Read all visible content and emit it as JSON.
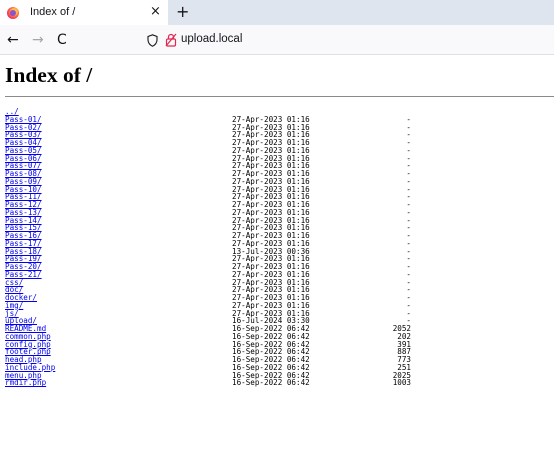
{
  "browser": {
    "tab_title": "Index of /",
    "tab_close": "×",
    "new_tab": "+",
    "back": "←",
    "forward": "→",
    "reload": "C",
    "url": "upload.local"
  },
  "page": {
    "heading": "Index of /",
    "parent_link": "../",
    "entries": [
      {
        "name": "Pass-01/",
        "date": "27-Apr-2023 01:16",
        "size": "-"
      },
      {
        "name": "Pass-02/",
        "date": "27-Apr-2023 01:16",
        "size": "-"
      },
      {
        "name": "Pass-03/",
        "date": "27-Apr-2023 01:16",
        "size": "-"
      },
      {
        "name": "Pass-04/",
        "date": "27-Apr-2023 01:16",
        "size": "-"
      },
      {
        "name": "Pass-05/",
        "date": "27-Apr-2023 01:16",
        "size": "-"
      },
      {
        "name": "Pass-06/",
        "date": "27-Apr-2023 01:16",
        "size": "-"
      },
      {
        "name": "Pass-07/",
        "date": "27-Apr-2023 01:16",
        "size": "-"
      },
      {
        "name": "Pass-08/",
        "date": "27-Apr-2023 01:16",
        "size": "-"
      },
      {
        "name": "Pass-09/",
        "date": "27-Apr-2023 01:16",
        "size": "-"
      },
      {
        "name": "Pass-10/",
        "date": "27-Apr-2023 01:16",
        "size": "-"
      },
      {
        "name": "Pass-11/",
        "date": "27-Apr-2023 01:16",
        "size": "-"
      },
      {
        "name": "Pass-12/",
        "date": "27-Apr-2023 01:16",
        "size": "-"
      },
      {
        "name": "Pass-13/",
        "date": "27-Apr-2023 01:16",
        "size": "-"
      },
      {
        "name": "Pass-14/",
        "date": "27-Apr-2023 01:16",
        "size": "-"
      },
      {
        "name": "Pass-15/",
        "date": "27-Apr-2023 01:16",
        "size": "-"
      },
      {
        "name": "Pass-16/",
        "date": "27-Apr-2023 01:16",
        "size": "-"
      },
      {
        "name": "Pass-17/",
        "date": "27-Apr-2023 01:16",
        "size": "-"
      },
      {
        "name": "Pass-18/",
        "date": "13-Jul-2023 00:36",
        "size": "-"
      },
      {
        "name": "Pass-19/",
        "date": "27-Apr-2023 01:16",
        "size": "-"
      },
      {
        "name": "Pass-20/",
        "date": "27-Apr-2023 01:16",
        "size": "-"
      },
      {
        "name": "Pass-21/",
        "date": "27-Apr-2023 01:16",
        "size": "-"
      },
      {
        "name": "css/",
        "date": "27-Apr-2023 01:16",
        "size": "-"
      },
      {
        "name": "doc/",
        "date": "27-Apr-2023 01:16",
        "size": "-"
      },
      {
        "name": "docker/",
        "date": "27-Apr-2023 01:16",
        "size": "-"
      },
      {
        "name": "img/",
        "date": "27-Apr-2023 01:16",
        "size": "-"
      },
      {
        "name": "js/",
        "date": "27-Apr-2023 01:16",
        "size": "-"
      },
      {
        "name": "upload/",
        "date": "16-Jul-2024 03:30",
        "size": "-"
      },
      {
        "name": "README.md",
        "date": "16-Sep-2022 06:42",
        "size": "2052"
      },
      {
        "name": "common.php",
        "date": "16-Sep-2022 06:42",
        "size": "202"
      },
      {
        "name": "config.php",
        "date": "16-Sep-2022 06:42",
        "size": "391"
      },
      {
        "name": "footer.php",
        "date": "16-Sep-2022 06:42",
        "size": "887"
      },
      {
        "name": "head.php",
        "date": "16-Sep-2022 06:42",
        "size": "773"
      },
      {
        "name": "include.php",
        "date": "16-Sep-2022 06:42",
        "size": "251"
      },
      {
        "name": "menu.php",
        "date": "16-Sep-2022 06:42",
        "size": "2025"
      },
      {
        "name": "rmdir.php",
        "date": "16-Sep-2022 06:42",
        "size": "1003"
      }
    ]
  }
}
